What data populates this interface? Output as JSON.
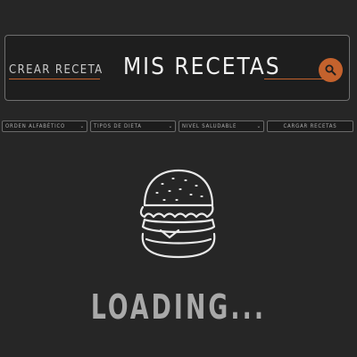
{
  "header": {
    "create_link_label": "CREAR RECETA",
    "title": "MIS RECETAS",
    "search": {
      "placeholder": "",
      "value": ""
    },
    "search_button_icon": "search-icon"
  },
  "filters": {
    "sort_label": "ORDEN ALFABÉTICO",
    "diet_label": "TIPOS DE DIETA",
    "health_label": "NIVEL SALUDABLE",
    "load_button_label": "CARGAR RECETAS",
    "dropdown_icon": "chevron-down-icon"
  },
  "loader": {
    "icon": "burger-icon",
    "text": "LOADING..."
  },
  "colors": {
    "background": "#262626",
    "accent": "#c4622d",
    "header_bg": "#1e1e1e",
    "title": "#f1f1f1",
    "loading_text": "#a9a9a9"
  }
}
